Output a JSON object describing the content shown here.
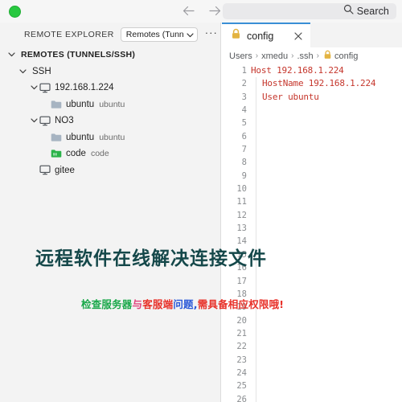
{
  "titlebar": {
    "back_icon": "arrow-left-icon",
    "forward_icon": "arrow-right-icon",
    "search_placeholder": "Search",
    "search_label": "Search",
    "search_icon": "search-icon",
    "traffic_light_color": "#28c840"
  },
  "sidebar": {
    "title": "REMOTE EXPLORER",
    "select_value": "Remotes (Tunnels/SSH)",
    "select_visible": "Remotes (Tunnel:",
    "more_label": "···",
    "tree": [
      {
        "label": "REMOTES (TUNNELS/SSH)",
        "desc": "",
        "icon": "",
        "chevron": "expanded",
        "indent": 0,
        "style": "strong"
      },
      {
        "label": "SSH",
        "desc": "",
        "icon": "",
        "chevron": "expanded",
        "indent": 1,
        "style": "normal"
      },
      {
        "label": "192.168.1.224",
        "desc": "",
        "icon": "monitor-icon",
        "chevron": "expanded",
        "indent": 2,
        "style": "normal"
      },
      {
        "label": "ubuntu",
        "desc": "ubuntu",
        "icon": "folder-icon",
        "chevron": "none",
        "indent": 3,
        "style": "normal"
      },
      {
        "label": "NO3",
        "desc": "",
        "icon": "monitor-icon",
        "chevron": "expanded",
        "indent": 2,
        "style": "normal"
      },
      {
        "label": "ubuntu",
        "desc": "ubuntu",
        "icon": "folder-icon",
        "chevron": "none",
        "indent": 3,
        "style": "normal"
      },
      {
        "label": "code",
        "desc": "code",
        "icon": "folder-green-icon",
        "chevron": "none",
        "indent": 3,
        "style": "normal"
      },
      {
        "label": "gitee",
        "desc": "",
        "icon": "monitor-icon",
        "chevron": "none",
        "indent": 2,
        "style": "normal"
      }
    ]
  },
  "editor": {
    "tab": {
      "label": "config",
      "icon": "lock-icon",
      "close_icon": "close-icon",
      "accent_color": "#3a8fd6"
    },
    "breadcrumb": [
      {
        "label": "Users",
        "icon": ""
      },
      {
        "label": "xmedu",
        "icon": ""
      },
      {
        "label": ".ssh",
        "icon": ""
      },
      {
        "label": "config",
        "icon": "lock-icon"
      }
    ],
    "code_color": "#c5362c",
    "lines": [
      {
        "n": "1",
        "text": "Host 192.168.1.224",
        "indent": false,
        "guide": false
      },
      {
        "n": "2",
        "text": "HostName 192.168.1.224",
        "indent": true,
        "guide": true
      },
      {
        "n": "3",
        "text": "User ubuntu",
        "indent": true,
        "guide": true
      },
      {
        "n": "4",
        "text": "",
        "indent": false,
        "guide": true
      },
      {
        "n": "5",
        "text": "",
        "indent": false,
        "guide": true
      },
      {
        "n": "6",
        "text": "",
        "indent": false,
        "guide": true
      },
      {
        "n": "7",
        "text": "",
        "indent": false,
        "guide": true
      },
      {
        "n": "8",
        "text": "",
        "indent": false,
        "guide": true
      },
      {
        "n": "9",
        "text": "",
        "indent": false,
        "guide": true
      },
      {
        "n": "10",
        "text": "",
        "indent": false,
        "guide": true
      },
      {
        "n": "11",
        "text": "",
        "indent": false,
        "guide": true
      },
      {
        "n": "12",
        "text": "",
        "indent": false,
        "guide": true
      },
      {
        "n": "13",
        "text": "",
        "indent": false,
        "guide": true
      },
      {
        "n": "14",
        "text": "",
        "indent": false,
        "guide": true
      },
      {
        "n": "15",
        "text": "",
        "indent": false,
        "guide": true
      },
      {
        "n": "16",
        "text": "",
        "indent": false,
        "guide": true
      },
      {
        "n": "17",
        "text": "",
        "indent": false,
        "guide": true
      },
      {
        "n": "18",
        "text": "",
        "indent": false,
        "guide": true
      },
      {
        "n": "19",
        "text": "",
        "indent": false,
        "guide": true
      },
      {
        "n": "20",
        "text": "",
        "indent": false,
        "guide": true
      },
      {
        "n": "21",
        "text": "",
        "indent": false,
        "guide": true
      },
      {
        "n": "22",
        "text": "",
        "indent": false,
        "guide": true
      },
      {
        "n": "23",
        "text": "",
        "indent": false,
        "guide": true
      },
      {
        "n": "24",
        "text": "",
        "indent": false,
        "guide": true
      },
      {
        "n": "25",
        "text": "",
        "indent": false,
        "guide": true
      },
      {
        "n": "26",
        "text": "",
        "indent": false,
        "guide": true
      }
    ]
  },
  "watermarks": {
    "headline": "远程软件在线解决连接文件",
    "headline_color": "#15484a",
    "subline_segments": [
      {
        "text": "检查服务器",
        "color": "#1aa84a"
      },
      {
        "text": "与",
        "color": "#e0427a"
      },
      {
        "text": "客服端",
        "color": "#e8322a"
      },
      {
        "text": "问题,",
        "color": "#2a59d8"
      },
      {
        "text": "需具备",
        "color": "#e8322a"
      },
      {
        "text": "相应权限哦!",
        "color": "#e8322a"
      }
    ]
  }
}
